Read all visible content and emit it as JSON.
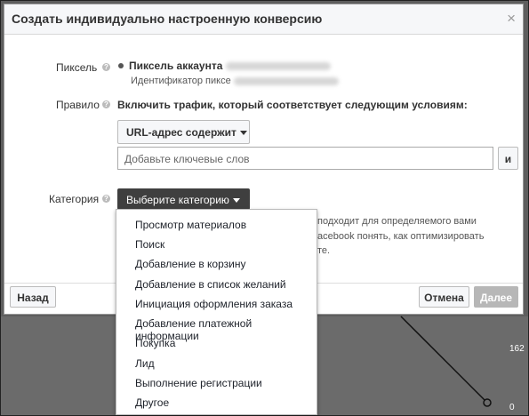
{
  "dialog": {
    "title": "Создать индивидуально настроенную конверсию",
    "close_glyph": "×"
  },
  "pixel": {
    "label": "Пиксель",
    "account_prefix": "Пиксель аккаунта",
    "id_prefix": "Идентификатор пиксе"
  },
  "rule": {
    "label": "Правило",
    "description": "Включить трафик, который соответствует следующим условиям:",
    "condition_select": "URL-адрес содержит",
    "keywords_placeholder": "Добавьте ключевые слов",
    "and_button": "и"
  },
  "category": {
    "label": "Категория",
    "select_label": "Выберите категорию",
    "hint_line1": "подходит для определяемого вами",
    "hint_line2": "acebook понять, как оптимизировать",
    "hint_line3": "те.",
    "options": [
      "Просмотр материалов",
      "Поиск",
      "Добавление в корзину",
      "Добавление в список желаний",
      "Инициация оформления заказа",
      "Добавление платежной информации",
      "Покупка",
      "Лид",
      "Выполнение регистрации",
      "Другое"
    ]
  },
  "footer": {
    "back": "Назад",
    "cancel": "Отмена",
    "next": "Далее"
  },
  "background": {
    "axis_top": "162",
    "axis_bottom": "0"
  }
}
